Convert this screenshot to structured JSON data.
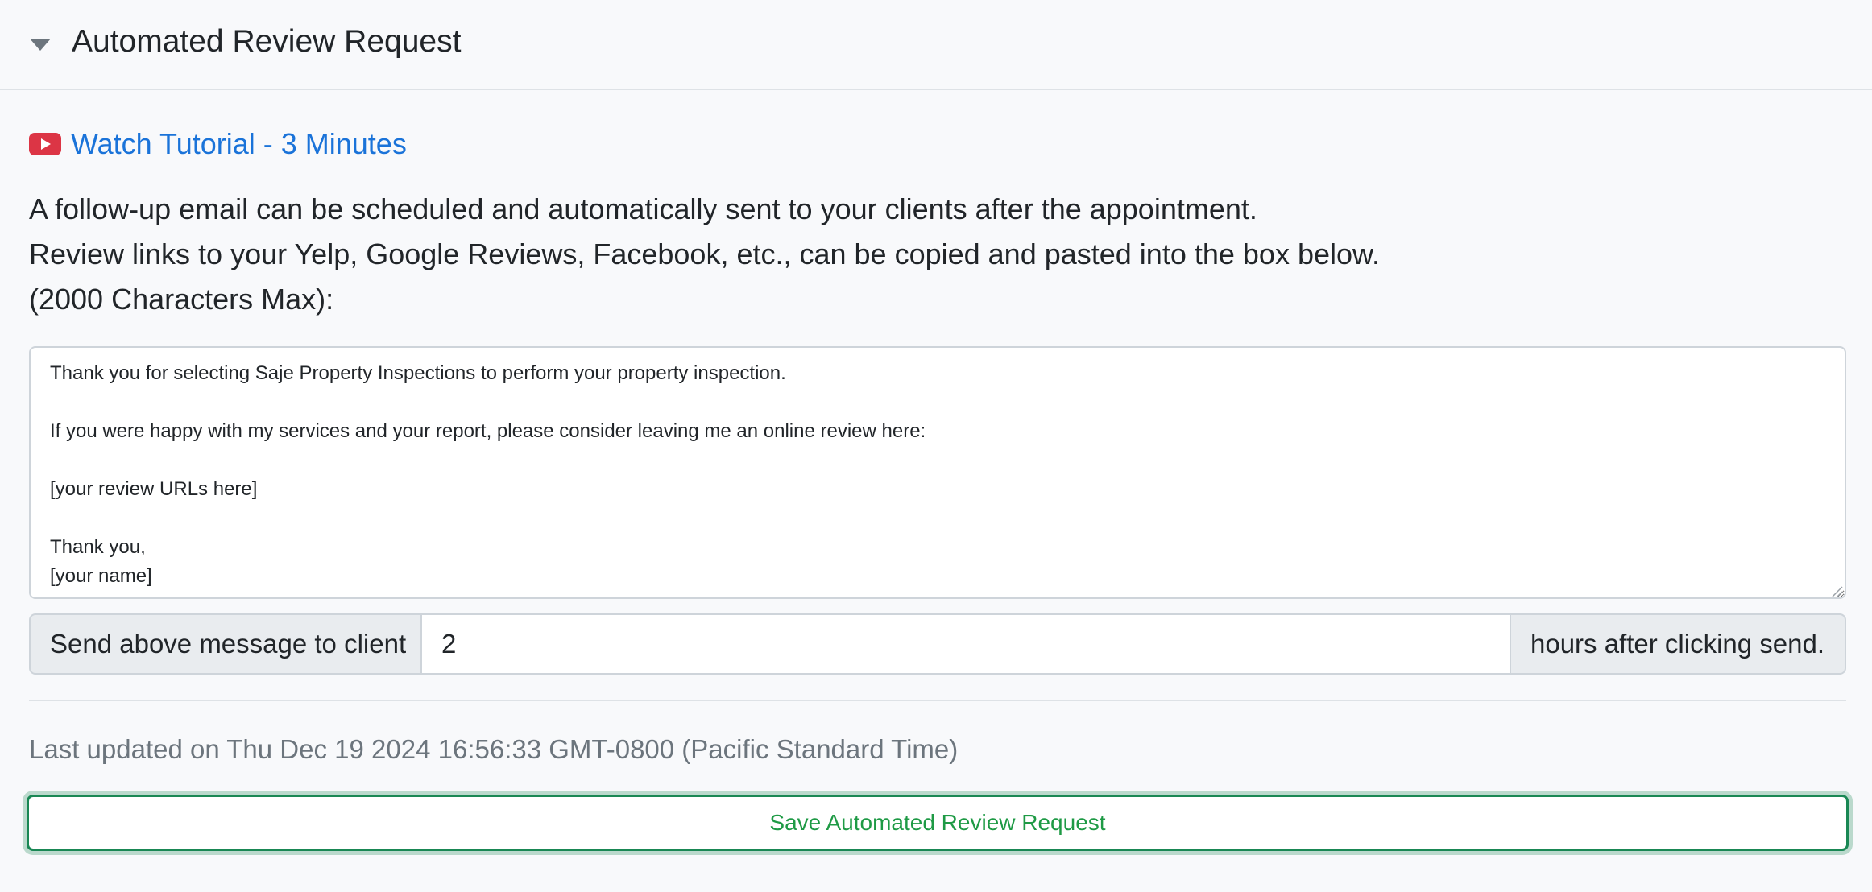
{
  "header": {
    "title": "Automated Review Request"
  },
  "tutorial": {
    "label": "Watch Tutorial - 3 Minutes",
    "icon": "youtube-play-icon",
    "color": "#1a73d9"
  },
  "description": {
    "line1": "A follow-up email can be scheduled and automatically sent to your clients after the appointment.",
    "line2": "Review links to your Yelp, Google Reviews, Facebook, etc., can be copied and pasted into the box below.",
    "line3": "(2000 Characters Max):"
  },
  "message": {
    "value": "Thank you for selecting Saje Property Inspections to perform your property inspection.\n\nIf you were happy with my services and your report, please consider leaving me an online review here:\n\n[your review URLs here]\n\nThank you,\n[your name]"
  },
  "schedule": {
    "prefix": "Send above message to client",
    "hours_value": "2",
    "suffix": "hours after clicking send."
  },
  "status": {
    "last_updated": "Last updated on Thu Dec 19 2024 16:56:33 GMT-0800 (Pacific Standard Time)"
  },
  "actions": {
    "save_label": "Save Automated Review Request",
    "save_color": "#198754"
  }
}
